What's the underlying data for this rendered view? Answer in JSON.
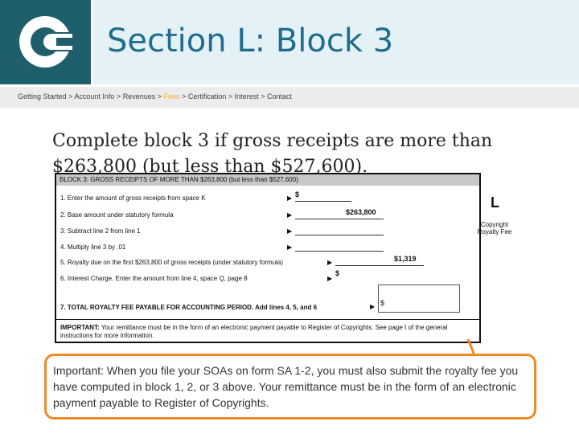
{
  "header": {
    "title": "Section L: Block 3",
    "logo_icon": "copyright-c-logo"
  },
  "breadcrumb": {
    "items": [
      "Getting Started",
      "Account Info",
      "Revenues",
      "Fees",
      "Certification",
      "Interest",
      "Contact"
    ],
    "separator": ">",
    "active": "Fees"
  },
  "intro": {
    "text": "Complete block 3 if gross receipts are more than $263,800 (but less than $527,600)."
  },
  "form": {
    "header": "BLOCK 3: GROSS RECEIPTS OF MORE THAN $263,800 (but less than $527,600)",
    "lines": [
      "1. Enter the amount of gross receipts from space K",
      "2. Base amount under statutory formula",
      "3. Subtract line 2 from line 1",
      "4. Multiply line 3 by .01",
      "5. Royalty due on the first $263,800 of gross receipts (under statutory formula)",
      "6. Interest Charge. Enter the amount from line 4, space Q, page 8",
      "7. TOTAL ROYALTY FEE PAYABLE FOR ACCOUNTING PERIOD. Add lines 4, 5, and 6"
    ],
    "line1_value": "$",
    "line2_value": "$263,800",
    "line5_value": "$1,319",
    "line6_value": "$",
    "line7_value": "$",
    "section_letter": "L",
    "section_label": "Copyright Royalty Fee",
    "important_label": "IMPORTANT:",
    "important_text": "Your remittance must be in the form of an electronic payment payable to Register of Copyrights. See page I of the general instructions for more information."
  },
  "callout": {
    "text": "Important: When you file your SOAs on form SA 1-2, you must also submit the royalty fee you have computed in block 1, 2, or 3 above. Your remittance must be in the form of an electronic payment payable to Register of Copyrights."
  },
  "colors": {
    "logo_bg": "#1f5f6b",
    "title": "#1f6d8c",
    "header_bg": "#e4f1f6",
    "active_crumb": "#f0b428",
    "callout_border": "#f08a24"
  }
}
